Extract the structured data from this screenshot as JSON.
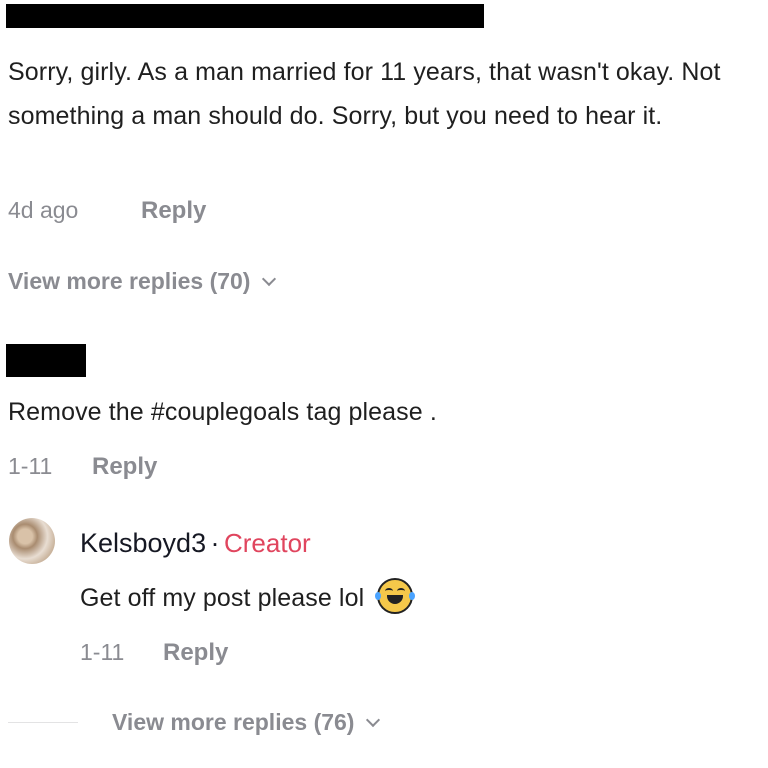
{
  "comment1": {
    "text": "Sorry, girly. As a man married for 11 years, that wasn't okay. Not something a man should do. Sorry, but you need to hear it.",
    "time": "4d ago",
    "reply_label": "Reply",
    "more_replies": "View more replies (70)"
  },
  "comment2": {
    "text": "Remove the #couplegoals tag please .",
    "time": "1-11",
    "reply_label": "Reply"
  },
  "reply1": {
    "username": "Kelsboyd3",
    "separator": "·",
    "badge": "Creator",
    "text": "Get off my post please lol",
    "emoji": "face-with-tears-of-joy",
    "time": "1-11",
    "reply_label": "Reply",
    "more_replies": "View more replies (76)"
  },
  "colors": {
    "creator": "#e0455e",
    "muted": "#8a8b91",
    "text": "#1f1f1f"
  }
}
